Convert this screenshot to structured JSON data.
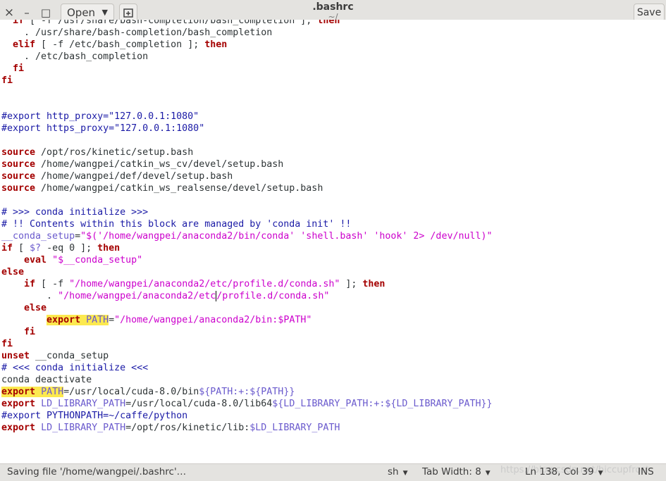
{
  "window": {
    "title": ".bashrc",
    "subtitle": "~/",
    "open_label": "Open",
    "save_label": "Save"
  },
  "status": {
    "message": "Saving file '/home/wangpei/.bashrc'…",
    "language": "sh",
    "tab_width": "Tab Width: 8",
    "cursor": "Ln 138, Col 39",
    "mode": "INS"
  },
  "watermark": "https://blog.csdn.net/hiccupfrost",
  "icons": {
    "close": "close-icon",
    "minimize": "minimize-icon",
    "maximize": "maximize-icon",
    "new_tab": "new-tab-icon",
    "dropdown": "chevron-down-icon"
  },
  "colors": {
    "keyword": "#a40000",
    "comment": "#1a1aa6",
    "string": "#cc00cc",
    "variable": "#6a5acd",
    "highlight": "#fce94f"
  },
  "code": [
    [
      [
        "  ",
        ""
      ],
      [
        "if",
        "kw"
      ],
      [
        " [ -f /usr/share/bash-completion/bash_completion ]; ",
        ""
      ],
      [
        "then",
        "kw"
      ]
    ],
    [
      [
        "    . /usr/share/bash-completion/bash_completion",
        ""
      ]
    ],
    [
      [
        "  ",
        ""
      ],
      [
        "elif",
        "kw"
      ],
      [
        " [ -f /etc/bash_completion ]; ",
        ""
      ],
      [
        "then",
        "kw"
      ]
    ],
    [
      [
        "    . /etc/bash_completion",
        ""
      ]
    ],
    [
      [
        "  ",
        ""
      ],
      [
        "fi",
        "kw"
      ]
    ],
    [
      [
        "fi",
        "kw"
      ]
    ],
    [
      [
        "",
        ""
      ]
    ],
    [
      [
        "",
        ""
      ]
    ],
    [
      [
        "#export http_proxy=\"127.0.0.1:1080\"",
        "cm"
      ]
    ],
    [
      [
        "#export https_proxy=\"127.0.0.1:1080\"",
        "cm"
      ]
    ],
    [
      [
        "",
        ""
      ]
    ],
    [
      [
        "source",
        "kw"
      ],
      [
        " /opt/ros/kinetic/setup.bash",
        ""
      ]
    ],
    [
      [
        "source",
        "kw"
      ],
      [
        " /home/wangpei/catkin_ws_cv/devel/setup.bash",
        ""
      ]
    ],
    [
      [
        "source",
        "kw"
      ],
      [
        " /home/wangpei/def/devel/setup.bash",
        ""
      ]
    ],
    [
      [
        "source",
        "kw"
      ],
      [
        " /home/wangpei/catkin_ws_realsense/devel/setup.bash",
        ""
      ]
    ],
    [
      [
        "",
        ""
      ]
    ],
    [
      [
        "# >>> conda initialize >>>",
        "cm"
      ]
    ],
    [
      [
        "# !! Contents within this block are managed by 'conda init' !!",
        "cm"
      ]
    ],
    [
      [
        "__conda_setup",
        "vr"
      ],
      [
        "=",
        ""
      ],
      [
        "\"$('/home/wangpei/anaconda2/bin/conda' 'shell.bash' 'hook' 2> /dev/null)\"",
        "st"
      ]
    ],
    [
      [
        "if",
        "kw"
      ],
      [
        " [ ",
        ""
      ],
      [
        "$?",
        "vr"
      ],
      [
        " -eq 0 ]; ",
        ""
      ],
      [
        "then",
        "kw"
      ]
    ],
    [
      [
        "    ",
        ""
      ],
      [
        "eval",
        "kw"
      ],
      [
        " ",
        ""
      ],
      [
        "\"$__conda_setup\"",
        "st"
      ]
    ],
    [
      [
        "else",
        "kw"
      ]
    ],
    [
      [
        "    ",
        ""
      ],
      [
        "if",
        "kw"
      ],
      [
        " [ -f ",
        ""
      ],
      [
        "\"/home/wangpei/anaconda2/etc/profile.d/conda.sh\"",
        "st"
      ],
      [
        " ]; ",
        ""
      ],
      [
        "then",
        "kw"
      ]
    ],
    [
      [
        "        . ",
        ""
      ],
      [
        "\"/home/wangpei/anaconda2/etc",
        "st"
      ],
      [
        "",
        "caret"
      ],
      [
        "/profile.d/conda.sh\"",
        "st"
      ]
    ],
    [
      [
        "    ",
        ""
      ],
      [
        "else",
        "kw"
      ]
    ],
    [
      [
        "        ",
        ""
      ],
      [
        "export",
        "kw hl"
      ],
      [
        " ",
        "hl"
      ],
      [
        "PATH",
        "vr hl"
      ],
      [
        "=",
        ""
      ],
      [
        "\"/home/wangpei/anaconda2/bin:$PATH\"",
        "st"
      ]
    ],
    [
      [
        "    ",
        ""
      ],
      [
        "fi",
        "kw"
      ]
    ],
    [
      [
        "fi",
        "kw"
      ]
    ],
    [
      [
        "unset",
        "kw"
      ],
      [
        " __conda_setup",
        ""
      ]
    ],
    [
      [
        "# <<< conda initialize <<<",
        "cm"
      ]
    ],
    [
      [
        "conda deactivate",
        ""
      ]
    ],
    [
      [
        "export",
        "kw hl"
      ],
      [
        " ",
        "hl"
      ],
      [
        "PATH",
        "vr hl"
      ],
      [
        "=/usr/local/cuda-8.0/bin",
        ""
      ],
      [
        "${PATH:+:${PATH}}",
        "vr"
      ]
    ],
    [
      [
        "export",
        "kw"
      ],
      [
        " ",
        ""
      ],
      [
        "LD_LIBRARY_PATH",
        "vr"
      ],
      [
        "=/usr/local/cuda-8.0/lib64",
        ""
      ],
      [
        "${LD_LIBRARY_PATH:+:${LD_LIBRARY_PATH}}",
        "vr"
      ]
    ],
    [
      [
        "#export PYTHONPATH=~/caffe/python",
        "cm"
      ]
    ],
    [
      [
        "export",
        "kw"
      ],
      [
        " ",
        ""
      ],
      [
        "LD_LIBRARY_PATH",
        "vr"
      ],
      [
        "=/opt/ros/kinetic/lib:",
        ""
      ],
      [
        "$LD_LIBRARY_PATH",
        "vr"
      ]
    ]
  ]
}
